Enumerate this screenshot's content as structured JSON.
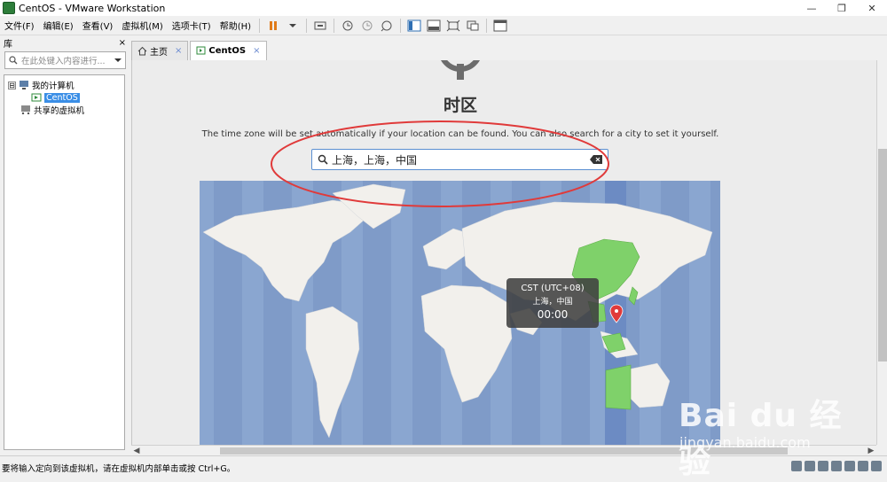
{
  "window": {
    "title": "CentOS - VMware Workstation",
    "min": "—",
    "restore": "❐",
    "close": "✕"
  },
  "menu": [
    "文件(F)",
    "编辑(E)",
    "查看(V)",
    "虚拟机(M)",
    "选项卡(T)",
    "帮助(H)"
  ],
  "library": {
    "title": "库",
    "close": "×",
    "search_placeholder": "在此处键入内容进行...",
    "tree": {
      "my_computer": "我的计算机",
      "vm": "CentOS",
      "shared": "共享的虚拟机",
      "toggle": "⊟"
    }
  },
  "tabs": [
    {
      "label": "主页",
      "close": "×"
    },
    {
      "label": "CentOS",
      "close": "×"
    }
  ],
  "installer": {
    "title": "时区",
    "description": "The time zone will be set automatically if your location can be found. You can also search for a city to set it yourself.",
    "search_value": "上海，上海，中国"
  },
  "tooltip": {
    "zone": "CST (UTC+08)",
    "city": "上海，中国",
    "time": "00:00"
  },
  "statusbar": {
    "message": "要将输入定向到该虚拟机，请在虚拟机内部单击或按 Ctrl+G。"
  },
  "watermark": {
    "brand": "Bai du 经验",
    "url": "jingyan.baidu.com"
  },
  "colors": {
    "map_ocean": "#7f9bc8",
    "land": "#f2f0ec",
    "selected_zone": "#7fd16a",
    "annotation": "#e03a3a",
    "accent": "#3a8ee6"
  }
}
